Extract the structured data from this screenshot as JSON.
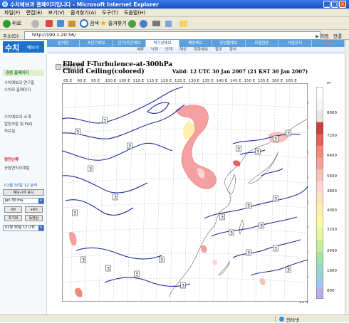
{
  "window": {
    "title": "수치예보과 홈페이지입니다 - Microsoft Internet Explorer"
  },
  "menu": [
    "파일(F)",
    "편집(E)",
    "보기(V)",
    "즐겨찾기(A)",
    "도구(T)",
    "도움말(H)"
  ],
  "toolbar": {
    "back": "뒤로",
    "search": "검색",
    "favorites": "즐겨찾기"
  },
  "address": {
    "label": "주소(D)",
    "url": "http://190.1.20.56/",
    "go": "이동",
    "links": "연결"
  },
  "site": {
    "logo_big": "수치",
    "logo_small": "예보과",
    "nav": [
      "분석장",
      "초단기예보",
      "단기/주간예보",
      "역기상예보",
      "해양예보",
      "앙상블예보",
      "모델검증",
      "사업공지",
      "도움말"
    ],
    "nav_active_index": 3,
    "subnav": [
      "예류",
      "낙뢰",
      "안개",
      "해상",
      "특화예보",
      "항공",
      "황사"
    ]
  },
  "sidebar": {
    "section": "관련 홈페이지",
    "items1": [
      "수치예보과 연구홈",
      "수치모 홈페이지"
    ],
    "items2": [
      "수치예보과 소개",
      "알림사항 및 FAQ",
      "자료실"
    ],
    "red_link": "청천난류",
    "link2": "공항연직사계열",
    "date_label": "01월 30일 12 분석",
    "forecast_label": "예보시각 표시",
    "select_value": "Jan 30 ma",
    "btn_minus6": "-6h",
    "btn_plus6": "+6h",
    "btn_first": "초기화",
    "btn_anim": "동영상",
    "time_select": "01월 30일 12 UTC"
  },
  "map": {
    "title_line1": "Ellrod F-Turbulence-at-300hPa",
    "title_line2": "Cloud Ceiling(colored)",
    "valid": "Valid: 12 UTC 30 Jan 2007 (21 KST 30 Jan 2007)",
    "lon_labels": [
      "85 E",
      "90 E",
      "95 E",
      "100 E",
      "105 E",
      "110 E",
      "115 E",
      "120 E",
      "125 E",
      "130 E",
      "135 E",
      "140 E",
      "145 E",
      "150 E",
      "155 E",
      "160 E",
      "165 E"
    ],
    "lat_labels": [
      "50 N",
      "45 N",
      "40 N",
      "35 N",
      "30 N",
      "25 N",
      "20 N",
      "15 N",
      "10 N"
    ],
    "contour_labels": [
      "3",
      "3",
      "3",
      "3",
      "3",
      "3",
      "3",
      "3",
      "3",
      "3",
      "3",
      "3",
      "3",
      "3",
      "3",
      "3",
      "3",
      "3",
      "3",
      "3",
      "3",
      "3",
      "3"
    ],
    "colorbar_unit": "m",
    "colorbar_labels": [
      "8000",
      "7200",
      "6400",
      "5600",
      "4800",
      "4000",
      "3200",
      "2400",
      "1600",
      "800"
    ],
    "colorbar_colors": [
      "#ffffff",
      "#f7f7f7",
      "#e8e8e8",
      "#c84040",
      "#e86060",
      "#f08a7a",
      "#f5a0a0",
      "#f7c0b8",
      "#ffd6d6",
      "#ffe2c0",
      "#ffefb0",
      "#fff8a0",
      "#e8f5a0",
      "#c8eda0",
      "#a8e0a8",
      "#98d8c8",
      "#a0c8e8",
      "#b8b0e0"
    ]
  },
  "status": {
    "zone": "인터넷"
  }
}
